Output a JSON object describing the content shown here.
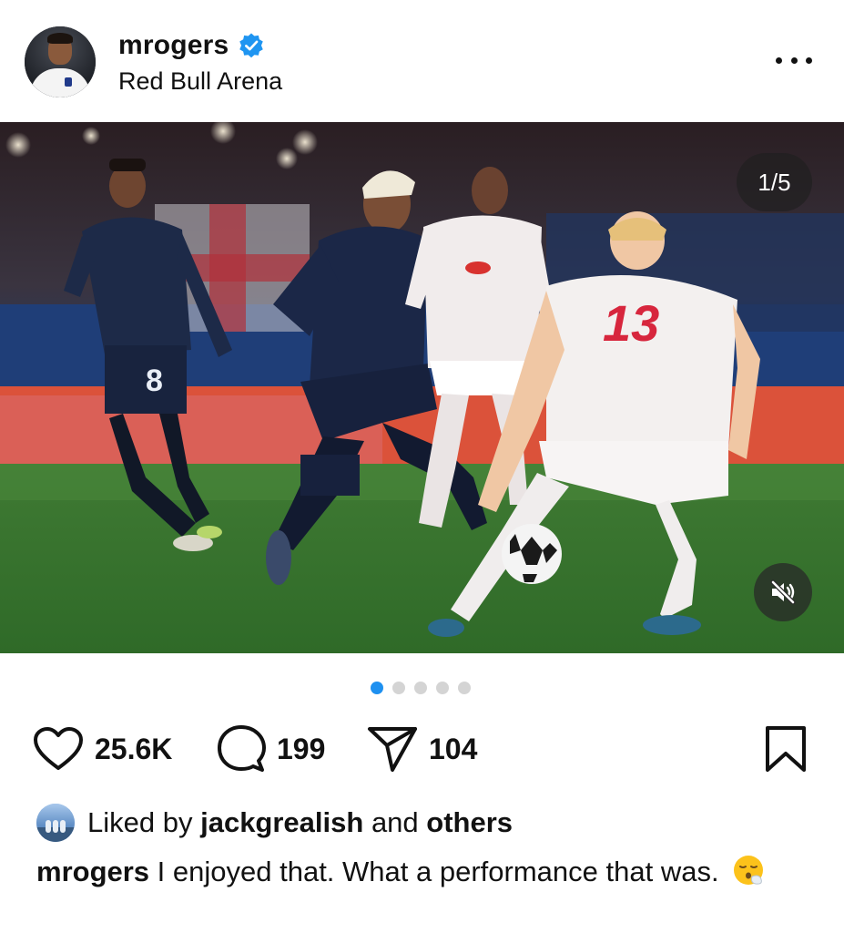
{
  "post": {
    "username": "mrogers",
    "location": "Red Bull Arena",
    "verified": true,
    "media_counter": "1/5",
    "carousel": {
      "total": 5,
      "active_index": 0
    },
    "player_numbers": {
      "attacker": "8",
      "defender": "13"
    }
  },
  "actions": {
    "likes_count": "25.6K",
    "comments_count": "199",
    "shares_count": "104"
  },
  "liked_by": {
    "prefix": "Liked by",
    "user": "jackgrealish",
    "connector": "and",
    "others": "others"
  },
  "caption": {
    "username": "mrogers",
    "text": "I enjoyed that. What a performance that was."
  },
  "colors": {
    "accent_blue": "#1e90f0",
    "verified_blue": "#1f95f1",
    "text": "#111111"
  },
  "icons": {
    "more": "more-horizontal-icon",
    "verified": "verified-badge-icon",
    "like": "heart-icon",
    "comment": "comment-bubble-icon",
    "share": "paper-plane-icon",
    "save": "bookmark-icon",
    "mute": "speaker-muted-icon",
    "caption_emoji": "exhaling-face-emoji"
  }
}
